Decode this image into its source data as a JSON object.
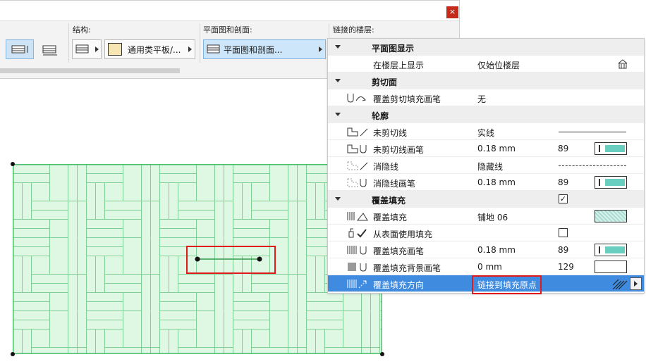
{
  "toolbar": {
    "close_label": "×",
    "sections": {
      "structure": "结构:",
      "plan_section": "平面图和剖面:",
      "linked_stories": "链接的楼层:"
    },
    "composite_button": "通用类平板/...",
    "plan_section_button": "平面图和剖面..."
  },
  "panel": {
    "rows": [
      {
        "type": "group",
        "title": "平面图显示"
      },
      {
        "type": "prop",
        "label": "在楼层上显示",
        "value": "仅始位楼层",
        "icon": "floor-stack-icon"
      },
      {
        "type": "group",
        "title": "剪切面"
      },
      {
        "type": "prop",
        "label": "覆盖剪切填充画笔",
        "value": "无",
        "icon": "pen-override-icon"
      },
      {
        "type": "group",
        "title": "轮廓"
      },
      {
        "type": "prop",
        "label": "未剪切线",
        "value": "实线",
        "icon": "uncut-line-icon"
      },
      {
        "type": "prop",
        "label": "未剪切线画笔",
        "value": "0.18 mm",
        "number": "89",
        "icon": "uncut-pen-icon"
      },
      {
        "type": "prop",
        "label": "消隐线",
        "value": "隐藏线",
        "icon": "hidden-line-icon"
      },
      {
        "type": "prop",
        "label": "消隐线画笔",
        "value": "0.18 mm",
        "number": "89",
        "icon": "hidden-pen-icon"
      },
      {
        "type": "group",
        "title": "覆盖填充",
        "checked": "✓"
      },
      {
        "type": "prop",
        "label": "覆盖填充",
        "value": "铺地 06",
        "icon": "cover-fill-icon"
      },
      {
        "type": "prop",
        "label": "从表面使用填充",
        "value": "",
        "icon": "surface-fill-icon"
      },
      {
        "type": "prop",
        "label": "覆盖填充画笔",
        "value": "0.18 mm",
        "number": "89",
        "icon": "fill-pen-icon"
      },
      {
        "type": "prop",
        "label": "覆盖填充背景画笔",
        "value": "0 mm",
        "number": "129",
        "icon": "bg-pen-icon"
      },
      {
        "type": "prop",
        "label": "覆盖填充方向",
        "value": "链接到填充原点",
        "icon": "fill-orientation-icon",
        "selected": true
      }
    ]
  },
  "colors": {
    "selection": "#3f8be0",
    "pen_fill": "#69cdbf",
    "slab_fill": "#dff8e4",
    "slab_line": "#4cc06b",
    "highlight": "#e0191b"
  }
}
